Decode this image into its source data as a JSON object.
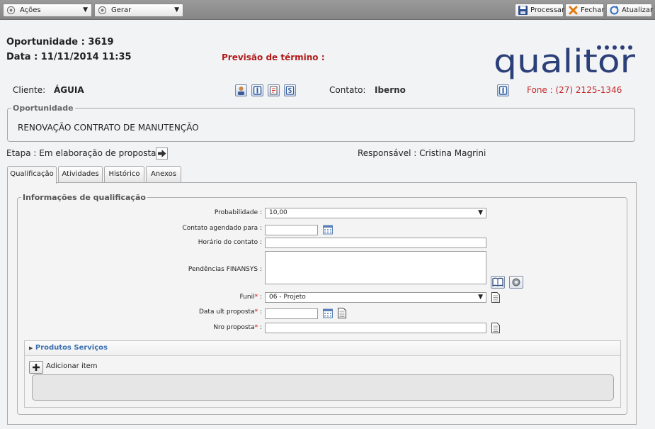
{
  "toolbar": {
    "acoes_label": "Ações",
    "gerar_label": "Gerar",
    "processar_label": "Processar",
    "fechar_label": "Fechar",
    "atualizar_label": "Atualizar"
  },
  "header": {
    "oportunidade_line": "Oportunidade : 3619",
    "data_line": "Data : 11/11/2014 11:35",
    "previsao_label": "Previsão de término :",
    "logo_text": "qualitor"
  },
  "cliente": {
    "label": "Cliente:",
    "value": "ÁGUIA"
  },
  "contato": {
    "label": "Contato:",
    "value": "Iberno",
    "fone": "Fone : (27) 2125-1346"
  },
  "oportunidade_box": {
    "legend": "Oportunidade",
    "text": "RENOVAÇÃO CONTRATO DE MANUTENÇÃO"
  },
  "etapa": "Etapa : Em elaboração de proposta",
  "responsavel": "Responsável : Cristina Magrini",
  "tabs": [
    {
      "label": "Qualificação",
      "active": true
    },
    {
      "label": "Atividades",
      "active": false
    },
    {
      "label": "Histórico",
      "active": false
    },
    {
      "label": "Anexos",
      "active": false
    }
  ],
  "qualificacao": {
    "legend": "Informações de qualificação",
    "probabilidade_label": "Probabilidade :",
    "probabilidade_value": "10,00",
    "contato_agendado_label": "Contato agendado para :",
    "contato_agendado_value": "",
    "horario_label": "Horário do contato :",
    "horario_value": "",
    "pendencias_label": "Pendências FINANSYS :",
    "pendencias_value": "",
    "funil_label": "Funil",
    "funil_suffix": " :",
    "funil_value": "06 - Projeto",
    "data_ult_label": "Data ult proposta",
    "data_ult_suffix": " :",
    "data_ult_value": "",
    "nro_label": "Nro proposta",
    "nro_suffix": " :",
    "nro_value": "",
    "required_mark": "*"
  },
  "produtos": {
    "title": "Produtos Serviços",
    "add_label": "Adicionar item"
  },
  "colors": {
    "accent_red": "#c0282a",
    "previsao_red": "#b01a1a",
    "logo_blue": "#2b3f78",
    "link_blue": "#3a6fb0"
  },
  "icons": [
    "settings-icon",
    "save-icon",
    "close-icon",
    "refresh-icon",
    "calendar-icon",
    "document-icon",
    "arrow-right-icon",
    "plus-icon",
    "book-icon"
  ]
}
